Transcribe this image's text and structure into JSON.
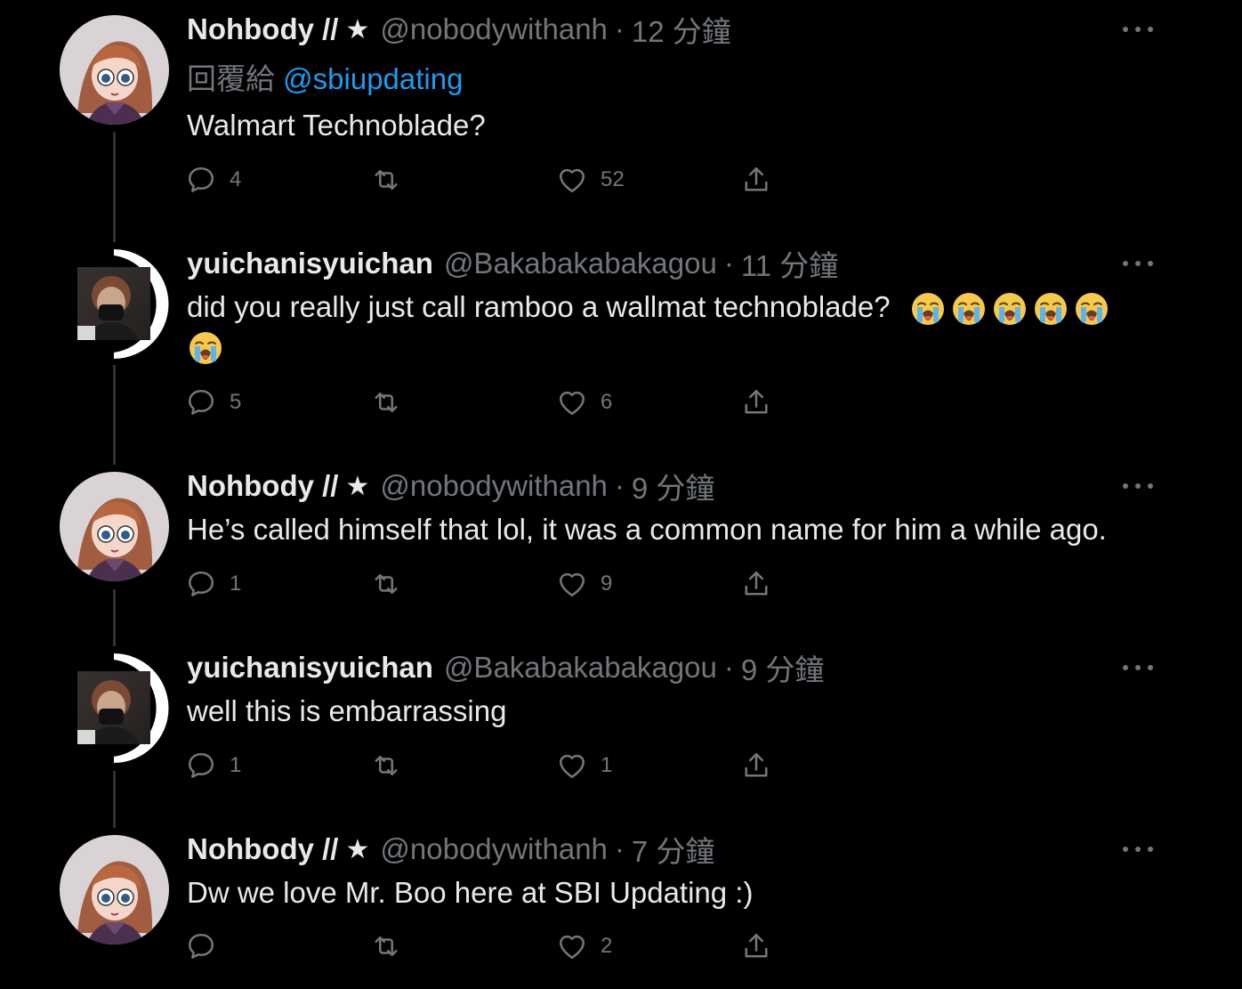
{
  "colors": {
    "background": "#000000",
    "text": "#e7e9ea",
    "muted": "#71767b",
    "link": "#1d9bf0"
  },
  "tweets": [
    {
      "name": "Nohbody //",
      "star": "★",
      "handle": "@nobodywithanh",
      "dot": "·",
      "time": "12 分鐘",
      "reply_prefix": "回覆給",
      "reply_mention": "@sbiupdating",
      "text": "Walmart Technoblade?",
      "replies": "4",
      "retweets": "",
      "likes": "52",
      "avatar": "anime-avatar"
    },
    {
      "name": "yuichanisyuichan",
      "handle": "@Bakabakabakagou",
      "dot": "·",
      "time": "11 分鐘",
      "text": "did you really just call ramboo a wallmat technoblade?",
      "emoji_count": 6,
      "emoji_name": "loudly-crying-face",
      "replies": "5",
      "retweets": "",
      "likes": "6",
      "avatar": "photo-avatar"
    },
    {
      "name": "Nohbody //",
      "star": "★",
      "handle": "@nobodywithanh",
      "dot": "·",
      "time": "9 分鐘",
      "text": "He’s called himself that lol, it was a common name for him a while ago.",
      "replies": "1",
      "retweets": "",
      "likes": "9",
      "avatar": "anime-avatar"
    },
    {
      "name": "yuichanisyuichan",
      "handle": "@Bakabakabakagou",
      "dot": "·",
      "time": "9 分鐘",
      "text": "well this is embarrassing",
      "replies": "1",
      "retweets": "",
      "likes": "1",
      "avatar": "photo-avatar"
    },
    {
      "name": "Nohbody //",
      "star": "★",
      "handle": "@nobodywithanh",
      "dot": "·",
      "time": "7 分鐘",
      "text": "Dw we love Mr. Boo here at SBI Updating :)",
      "replies": "",
      "retweets": "",
      "likes": "2",
      "avatar": "anime-avatar"
    }
  ]
}
